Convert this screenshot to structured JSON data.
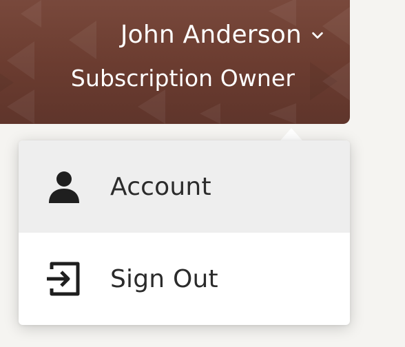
{
  "header": {
    "user_name": "John Anderson",
    "user_role": "Subscription Owner",
    "chevron_icon": "chevron-down-icon",
    "banner_color": "#6b3c30"
  },
  "menu": {
    "items": [
      {
        "label": "Account",
        "icon": "user-icon",
        "active": true
      },
      {
        "label": "Sign Out",
        "icon": "sign-out-icon",
        "active": false
      }
    ],
    "hover_background": "#eeeeee"
  }
}
